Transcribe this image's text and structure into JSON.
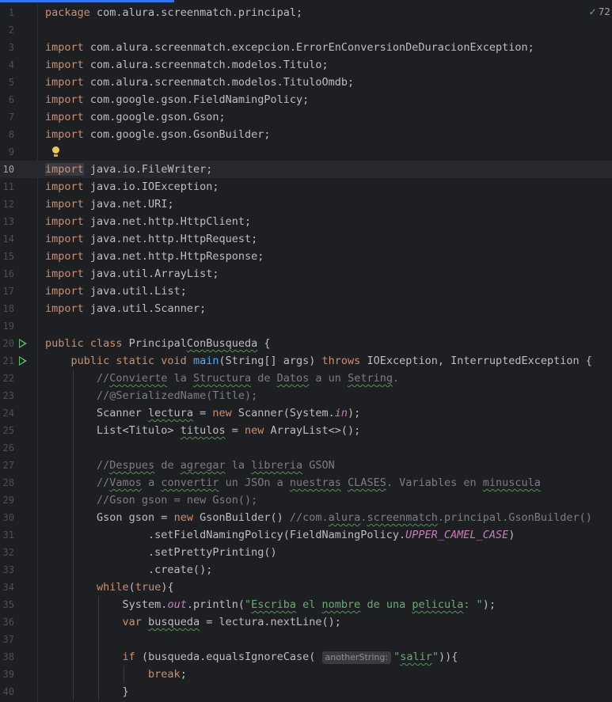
{
  "inspection": {
    "icon": "check-icon",
    "count": "72"
  },
  "lines": [
    {
      "n": "1",
      "code": "<span class='k'>package</span> com.alura.screenmatch.principal;"
    },
    {
      "n": "2",
      "code": ""
    },
    {
      "n": "3",
      "code": "<span class='k'>import</span> com.alura.screenmatch.excepcion.ErrorEnConversionDeDuracionException;"
    },
    {
      "n": "4",
      "code": "<span class='k'>import</span> com.alura.screenmatch.modelos.Titulo;"
    },
    {
      "n": "5",
      "code": "<span class='k'>import</span> com.alura.screenmatch.modelos.TituloOmdb;"
    },
    {
      "n": "6",
      "code": "<span class='k'>import</span> com.google.gson.FieldNamingPolicy;"
    },
    {
      "n": "7",
      "code": "<span class='k'>import</span> com.google.gson.Gson;"
    },
    {
      "n": "8",
      "code": "<span class='k'>import</span> com.google.gson.GsonBuilder;"
    },
    {
      "n": "9",
      "code": "",
      "bulb": true
    },
    {
      "n": "10",
      "code": "<span class='k hl'>import</span> java.io.FileWriter;",
      "current": true
    },
    {
      "n": "11",
      "code": "<span class='k'>import</span> java.io.IOException;"
    },
    {
      "n": "12",
      "code": "<span class='k'>import</span> java.net.URI;"
    },
    {
      "n": "13",
      "code": "<span class='k'>import</span> java.net.http.HttpClient;"
    },
    {
      "n": "14",
      "code": "<span class='k'>import</span> java.net.http.HttpRequest;"
    },
    {
      "n": "15",
      "code": "<span class='k'>import</span> java.net.http.HttpResponse;"
    },
    {
      "n": "16",
      "code": "<span class='k'>import</span> java.util.ArrayList;"
    },
    {
      "n": "17",
      "code": "<span class='k'>import</span> java.util.List;"
    },
    {
      "n": "18",
      "code": "<span class='k'>import</span> java.util.Scanner;"
    },
    {
      "n": "19",
      "code": ""
    },
    {
      "n": "20",
      "code": "<span class='k'>public class</span> Principal<span class='wv'>ConBusqueda</span> {",
      "run": true
    },
    {
      "n": "21",
      "code": "    <span class='k'>public static void</span> <span class='fn'>main</span>(String[] args) <span class='k'>throws</span> IOException, InterruptedException {",
      "run": true
    },
    {
      "n": "22",
      "code": "        <span class='c'>//<span class='wv'>Convierte</span> la <span class='wv'>Structura</span> de <span class='wv'>Datos</span> a un <span class='wv'>Setring</span>.</span>"
    },
    {
      "n": "23",
      "code": "        <span class='c'>//@SerializedName(Title);</span>"
    },
    {
      "n": "24",
      "code": "        Scanner <span class='wv'>lectura</span> = <span class='k'>new</span> Scanner(System.<span class='st'>in</span>);"
    },
    {
      "n": "25",
      "code": "        List&lt;Titulo&gt; <span class='wv'>titulos</span> = <span class='k'>new</span> ArrayList&lt;&gt;();"
    },
    {
      "n": "26",
      "code": ""
    },
    {
      "n": "27",
      "code": "        <span class='c'>//<span class='wv'>Despues</span> de <span class='wv'>agregar</span> la <span class='wv'>libreria</span> GSON</span>"
    },
    {
      "n": "28",
      "code": "        <span class='c'>//<span class='wv'>Vamos</span> a <span class='wv'>convertir</span> un JSOn a <span class='wv'>nuestras</span> <span class='wv'>CLASES</span>. Variables en <span class='wv'>minuscula</span></span>"
    },
    {
      "n": "29",
      "code": "        <span class='c'>//Gson gson = new Gson();</span>"
    },
    {
      "n": "30",
      "code": "        Gson gson = <span class='k'>new</span> GsonBuilder() <span class='c'>//com.<span class='wv'>alura</span>.<span class='wv'>screenmatch</span>.principal.GsonBuilder()</span>"
    },
    {
      "n": "31",
      "code": "                .setFieldNamingPolicy(FieldNamingPolicy.<span class='st'>UPPER_CAMEL_CASE</span>)"
    },
    {
      "n": "32",
      "code": "                .setPrettyPrinting()"
    },
    {
      "n": "33",
      "code": "                .create();"
    },
    {
      "n": "34",
      "code": "        <span class='k'>while</span>(<span class='k'>true</span>){"
    },
    {
      "n": "35",
      "code": "            System.<span class='st'>out</span>.println(<span class='s'>\"<span class='wv'>Escriba</span> el <span class='wv'>nombre</span> de una <span class='wv'>pelicula</span>: \"</span>);"
    },
    {
      "n": "36",
      "code": "            <span class='k'>var</span> <span class='wv'>busqueda</span> = lectura.nextLine();"
    },
    {
      "n": "37",
      "code": ""
    },
    {
      "n": "38",
      "code": "            <span class='k'>if</span> (busqueda.equalsIgnoreCase( <span class='hint'>anotherString:</span><span class='s'>\"<span class='wv'>salir</span>\"</span>)){"
    },
    {
      "n": "39",
      "code": "                <span class='k'>break</span>;"
    },
    {
      "n": "40",
      "code": "            }"
    }
  ]
}
